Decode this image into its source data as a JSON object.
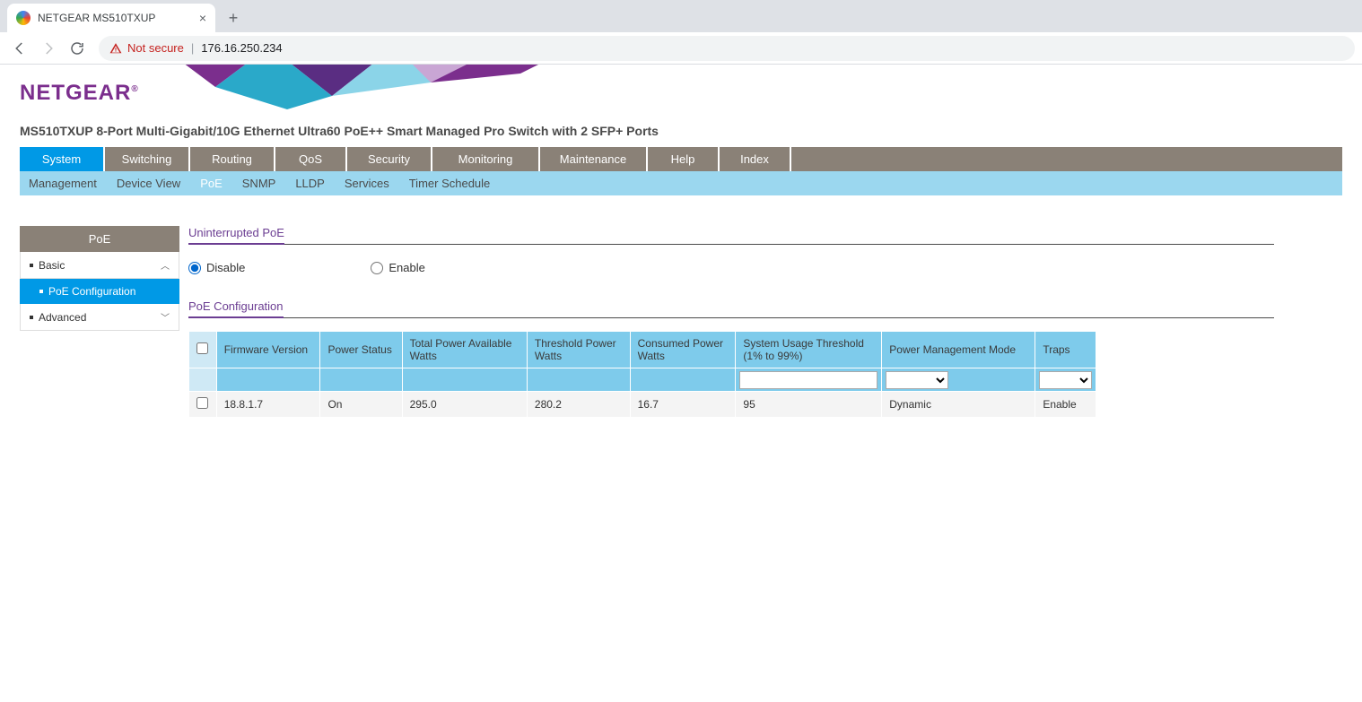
{
  "browser": {
    "tab_title": "NETGEAR MS510TXUP",
    "not_secure_label": "Not secure",
    "address": "176.16.250.234"
  },
  "header": {
    "logo_text": "NETGEAR",
    "product_desc": "MS510TXUP 8-Port Multi-Gigabit/10G Ethernet Ultra60 PoE++ Smart Managed Pro Switch with 2 SFP+ Ports"
  },
  "mainnav": {
    "items": [
      "System",
      "Switching",
      "Routing",
      "QoS",
      "Security",
      "Monitoring",
      "Maintenance",
      "Help",
      "Index"
    ],
    "active": "System"
  },
  "subnav": {
    "items": [
      "Management",
      "Device View",
      "PoE",
      "SNMP",
      "LLDP",
      "Services",
      "Timer Schedule"
    ],
    "active": "PoE"
  },
  "sidebar": {
    "header": "PoE",
    "basic_label": "Basic",
    "poe_config_label": "PoE Configuration",
    "advanced_label": "Advanced"
  },
  "uninterrupted": {
    "title": "Uninterrupted PoE",
    "disable_label": "Disable",
    "enable_label": "Enable",
    "selected": "Disable"
  },
  "poeconfig": {
    "title": "PoE Configuration",
    "headers": {
      "firmware": "Firmware Version",
      "power_status": "Power Status",
      "total_power": "Total Power Available Watts",
      "threshold_power": "Threshold Power Watts",
      "consumed_power": "Consumed Power Watts",
      "usage_threshold": "System Usage Threshold (1% to 99%)",
      "pmm": "Power Management Mode",
      "traps": "Traps"
    },
    "input_row": {
      "usage_threshold": "",
      "pmm": "",
      "traps": ""
    },
    "row": {
      "firmware": "18.8.1.7",
      "power_status": "On",
      "total_power": "295.0",
      "threshold_power": "280.2",
      "consumed_power": "16.7",
      "usage_threshold": "95",
      "pmm": "Dynamic",
      "traps": "Enable"
    }
  }
}
